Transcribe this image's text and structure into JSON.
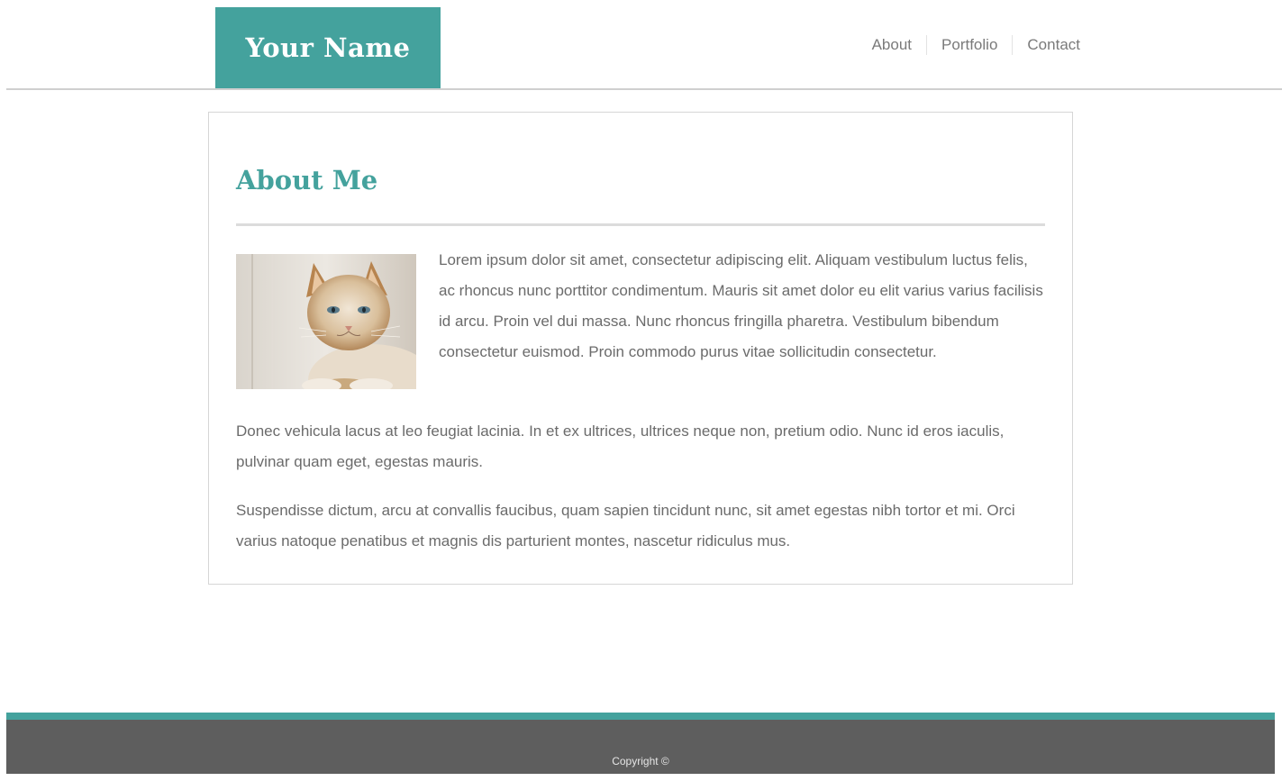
{
  "header": {
    "logo_text": "Your Name",
    "nav": [
      {
        "label": "About"
      },
      {
        "label": "Portfolio"
      },
      {
        "label": "Contact"
      }
    ]
  },
  "main": {
    "title": "About Me",
    "image_alt": "cat-photo",
    "paragraphs": [
      "Lorem ipsum dolor sit amet, consectetur adipiscing elit. Aliquam vestibulum luctus felis, ac rhoncus nunc porttitor condimentum. Mauris sit amet dolor eu elit varius varius facilisis id arcu. Proin vel dui massa. Nunc rhoncus fringilla pharetra. Vestibulum bibendum consectetur euismod. Proin commodo purus vitae sollicitudin consectetur.",
      "Donec vehicula lacus at leo feugiat lacinia. In et ex ultrices, ultrices neque non, pretium odio. Nunc id eros iaculis, pulvinar quam eget, egestas mauris.",
      "Suspendisse dictum, arcu at convallis faucibus, quam sapien tincidunt nunc, sit amet egestas nibh tortor et mi. Orci varius natoque penatibus et magnis dis parturient montes, nascetur ridiculus mus."
    ]
  },
  "footer": {
    "copyright": "Copyright ©"
  },
  "colors": {
    "accent": "#44a29d",
    "footer_bg": "#5e5e5e",
    "body_text": "#6b6b6b",
    "nav_text": "#7a7a7a"
  }
}
